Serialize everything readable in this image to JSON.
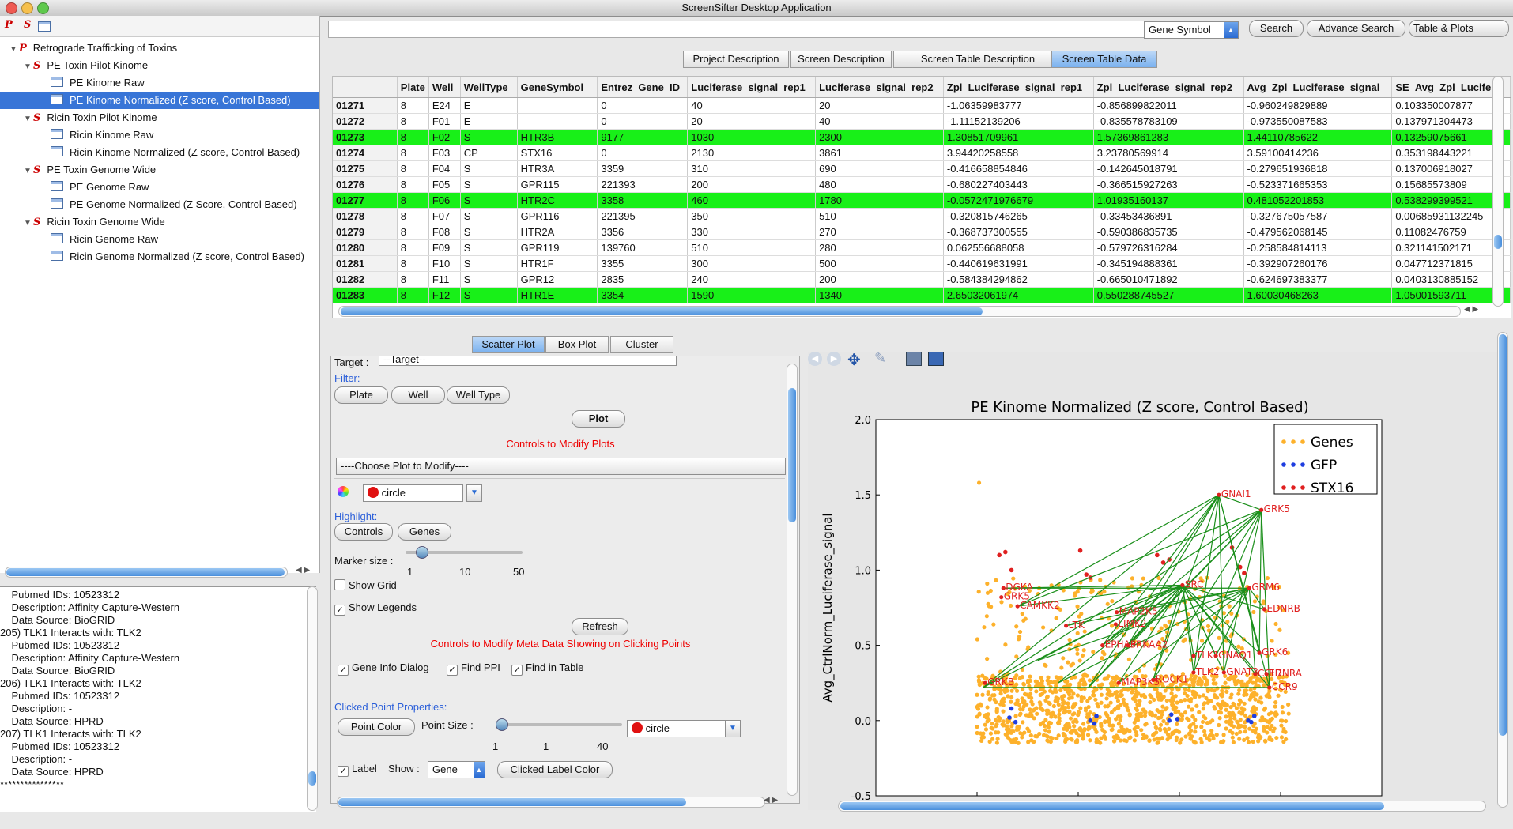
{
  "window": {
    "title": "ScreenSifter Desktop Application"
  },
  "tree": {
    "root": "Retrograde Trafficking of Toxins",
    "groups": [
      {
        "label": "PE Toxin Pilot Kinome",
        "items": [
          "PE  Kinome Raw",
          "PE Kinome Normalized (Z score, Control Based)"
        ]
      },
      {
        "label": "Ricin Toxin Pilot Kinome",
        "items": [
          "Ricin Kinome Raw",
          "Ricin Kinome Normalized (Z score, Control Based)"
        ]
      },
      {
        "label": "PE Toxin Genome Wide",
        "items": [
          "PE Genome Raw",
          "PE Genome Normalized (Z Score, Control Based)"
        ]
      },
      {
        "label": "Ricin Toxin Genome Wide",
        "items": [
          "Ricin Genome Raw",
          "Ricin Genome Normalized (Z score, Control Based)"
        ]
      }
    ]
  },
  "console": {
    "lines": [
      "    Pubmed IDs: 10523312",
      "    Description: Affinity Capture-Western",
      "    Data Source: BioGRID",
      "205) TLK1 Interacts with: TLK2",
      "    Pubmed IDs: 10523312",
      "    Description: Affinity Capture-Western",
      "    Data Source: BioGRID",
      "206) TLK1 Interacts with: TLK2",
      "    Pubmed IDs: 10523312",
      "    Description: -",
      "    Data Source: HPRD",
      "207) TLK1 Interacts with: TLK2",
      "    Pubmed IDs: 10523312",
      "    Description: -",
      "    Data Source: HPRD",
      "****************"
    ]
  },
  "search": {
    "value": "",
    "field": "Gene Symbol",
    "search_label": "Search",
    "advance_label": "Advance Search",
    "view_label": "Table & Plots"
  },
  "tabs": [
    "Project Description",
    "Screen Description",
    "Screen Table Description",
    "Screen Table Data"
  ],
  "table": {
    "columns": [
      "",
      "Plate",
      "Well",
      "WellType",
      "GeneSymbol",
      "Entrez_Gene_ID",
      "Luciferase_signal_rep1",
      "Luciferase_signal_rep2",
      "Zpl_Luciferase_signal_rep1",
      "Zpl_Luciferase_signal_rep2",
      "Avg_Zpl_Luciferase_signal",
      "SE_Avg_Zpl_Lucife"
    ],
    "rows": [
      {
        "hl": false,
        "cells": [
          "01271",
          "8",
          "E24",
          "E",
          "",
          "0",
          "40",
          "20",
          "-1.06359983777",
          "-0.856899822011",
          "-0.960249829889",
          "0.103350007877"
        ]
      },
      {
        "hl": false,
        "cells": [
          "01272",
          "8",
          "F01",
          "E",
          "",
          "0",
          "20",
          "40",
          "-1.11152139206",
          "-0.835578783109",
          "-0.973550087583",
          "0.137971304473"
        ]
      },
      {
        "hl": true,
        "cells": [
          "01273",
          "8",
          "F02",
          "S",
          "HTR3B",
          "9177",
          "1030",
          "2300",
          "1.30851709961",
          "1.57369861283",
          "1.44110785622",
          "0.13259075661"
        ]
      },
      {
        "hl": false,
        "cells": [
          "01274",
          "8",
          "F03",
          "CP",
          "STX16",
          "0",
          "2130",
          "3861",
          "3.94420258558",
          "3.23780569914",
          "3.59100414236",
          "0.353198443221"
        ]
      },
      {
        "hl": false,
        "cells": [
          "01275",
          "8",
          "F04",
          "S",
          "HTR3A",
          "3359",
          "310",
          "690",
          "-0.416658854846",
          "-0.142645018791",
          "-0.279651936818",
          "0.137006918027"
        ]
      },
      {
        "hl": false,
        "cells": [
          "01276",
          "8",
          "F05",
          "S",
          "GPR115",
          "221393",
          "200",
          "480",
          "-0.680227403443",
          "-0.366515927263",
          "-0.523371665353",
          "0.15685573809"
        ]
      },
      {
        "hl": true,
        "cells": [
          "01277",
          "8",
          "F06",
          "S",
          "HTR2C",
          "3358",
          "460",
          "1780",
          "-0.0572471976679",
          "1.01935160137",
          "0.481052201853",
          "0.538299399521"
        ]
      },
      {
        "hl": false,
        "cells": [
          "01278",
          "8",
          "F07",
          "S",
          "GPR116",
          "221395",
          "350",
          "510",
          "-0.320815746265",
          "-0.33453436891",
          "-0.327675057587",
          "0.00685931132245"
        ]
      },
      {
        "hl": false,
        "cells": [
          "01279",
          "8",
          "F08",
          "S",
          "HTR2A",
          "3356",
          "330",
          "270",
          "-0.368737300555",
          "-0.590386835735",
          "-0.479562068145",
          "0.11082476759"
        ]
      },
      {
        "hl": false,
        "cells": [
          "01280",
          "8",
          "F09",
          "S",
          "GPR119",
          "139760",
          "510",
          "280",
          "0.062556688058",
          "-0.579726316284",
          "-0.258584814113",
          "0.321141502171"
        ]
      },
      {
        "hl": false,
        "cells": [
          "01281",
          "8",
          "F10",
          "S",
          "HTR1F",
          "3355",
          "300",
          "500",
          "-0.440619631991",
          "-0.345194888361",
          "-0.392907260176",
          "0.047712371815"
        ]
      },
      {
        "hl": false,
        "cells": [
          "01282",
          "8",
          "F11",
          "S",
          "GPR12",
          "2835",
          "240",
          "200",
          "-0.584384294862",
          "-0.665010471892",
          "-0.624697383377",
          "0.0403130885152"
        ]
      },
      {
        "hl": true,
        "cells": [
          "01283",
          "8",
          "F12",
          "S",
          "HTR1E",
          "3354",
          "1590",
          "1340",
          "2.65032061974",
          "0.550288745527",
          "1.60030468263",
          "1.05001593711"
        ]
      }
    ]
  },
  "plot_tabs": [
    "Scatter Plot",
    "Box Plot",
    "Cluster"
  ],
  "controls": {
    "target_label": "Target :",
    "target_value": "--Target--",
    "filter_label": "Filter:",
    "filter_buttons": [
      "Plate",
      "Well",
      "Well Type"
    ],
    "plot_button": "Plot",
    "modify_title": "Controls to Modify Plots",
    "choose_plot": "----Choose Plot to Modify----",
    "marker_shape": "circle",
    "highlight_label": "Highlight:",
    "highlight_buttons": [
      "Controls",
      "Genes"
    ],
    "marker_size_label": "Marker size :",
    "marker_ticks": [
      "1",
      "10",
      "50"
    ],
    "marker_level": 0.1,
    "show_grid": "Show Grid",
    "show_legends": "Show Legends",
    "refresh": "Refresh",
    "meta_title": "Controls to Modify Meta Data Showing on Clicking Points",
    "meta_checks": [
      "Gene Info Dialog",
      "Find PPI",
      "Find in Table"
    ],
    "clicked_props": "Clicked Point Properties:",
    "point_color": "Point Color",
    "point_size": "Point Size :",
    "point_ticks": [
      "1",
      "1",
      "40"
    ],
    "point_level": 0.0,
    "clicked_shape": "circle",
    "label_check": "Label",
    "show_label": "Show :",
    "show_value": "Gene",
    "clicked_label_color": "Clicked Label Color"
  },
  "chart_data": {
    "type": "scatter",
    "title": "PE Kinome Normalized (Z score, Control Based)",
    "ylabel": "Avg_CtrlNorm_Luciferase_signal",
    "xlim": [
      -500,
      2000
    ],
    "ylim": [
      -0.5,
      2.0
    ],
    "xticks": [
      "-500",
      "0",
      "500",
      "1000",
      "1500",
      "20"
    ],
    "yticks": [
      "-0.5",
      "0.0",
      "0.5",
      "1.0",
      "1.5",
      "2.0"
    ],
    "legend": [
      {
        "name": "Genes",
        "color": "#fdb12b"
      },
      {
        "name": "GFP",
        "color": "#1f3ee0"
      },
      {
        "name": "STX16",
        "color": "#e02020"
      }
    ],
    "legend_position": "top-right",
    "gene_labels": [
      {
        "text": "GNAI1",
        "x": 1195,
        "y": 1.5
      },
      {
        "text": "GRK5",
        "x": 1405,
        "y": 1.4
      },
      {
        "text": "SRC",
        "x": 1015,
        "y": 0.9
      },
      {
        "text": "GRM6",
        "x": 1345,
        "y": 0.88
      },
      {
        "text": "DGKA",
        "x": 130,
        "y": 0.88
      },
      {
        "text": "GRK5",
        "x": 120,
        "y": 0.82
      },
      {
        "text": "CAMKK2",
        "x": 200,
        "y": 0.76
      },
      {
        "text": "EDNRB",
        "x": 1420,
        "y": 0.74
      },
      {
        "text": "MAP2K5",
        "x": 690,
        "y": 0.72
      },
      {
        "text": "LIMK2",
        "x": 685,
        "y": 0.64
      },
      {
        "text": "LTK",
        "x": 440,
        "y": 0.63
      },
      {
        "text": "EPHA3",
        "x": 620,
        "y": 0.5
      },
      {
        "text": "PRKAA2",
        "x": 745,
        "y": 0.5
      },
      {
        "text": "TLK1",
        "x": 1070,
        "y": 0.43
      },
      {
        "text": "GNAQ1",
        "x": 1180,
        "y": 0.43
      },
      {
        "text": "GRK6",
        "x": 1395,
        "y": 0.45
      },
      {
        "text": "TLK2",
        "x": 1070,
        "y": 0.32
      },
      {
        "text": "GNAT3",
        "x": 1220,
        "y": 0.32
      },
      {
        "text": "CCL7",
        "x": 1375,
        "y": 0.31
      },
      {
        "text": "EDNRA",
        "x": 1430,
        "y": 0.31
      },
      {
        "text": "CCR9",
        "x": 1445,
        "y": 0.22
      },
      {
        "text": "MAP3K5",
        "x": 700,
        "y": 0.25
      },
      {
        "text": "ROCK1",
        "x": 870,
        "y": 0.27
      },
      {
        "text": "GRKB",
        "x": 40,
        "y": 0.25
      }
    ]
  }
}
